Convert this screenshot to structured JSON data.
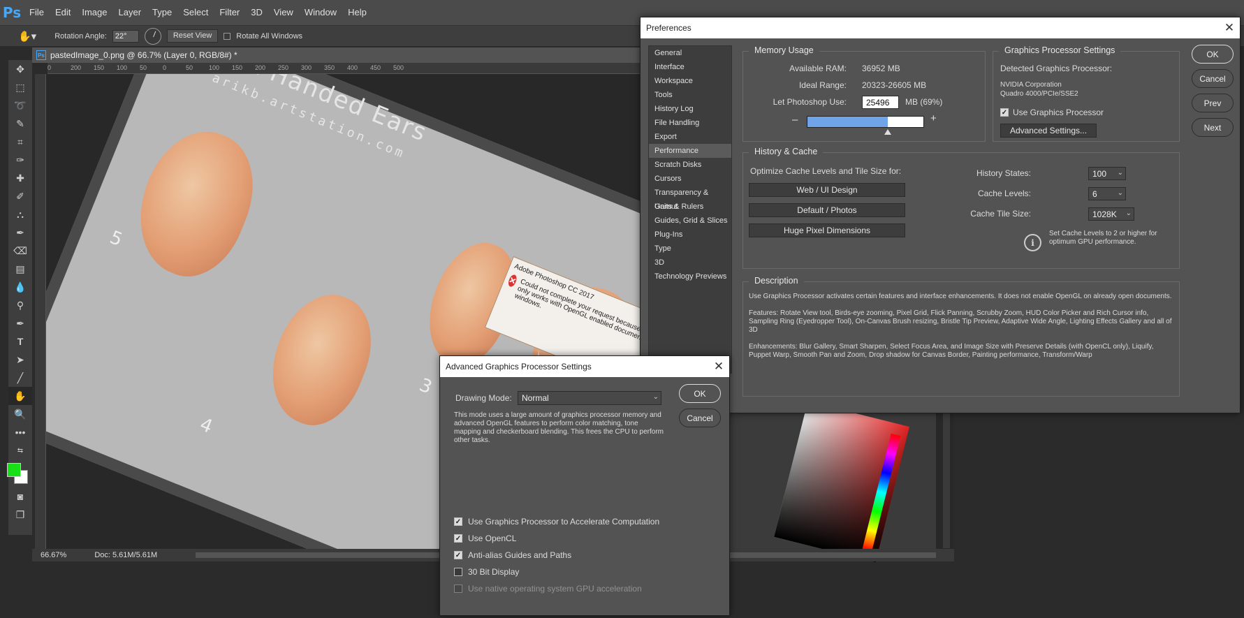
{
  "app": {
    "logo": "Ps",
    "menus": [
      "File",
      "Edit",
      "Image",
      "Layer",
      "Type",
      "Select",
      "Filter",
      "3D",
      "View",
      "Window",
      "Help"
    ]
  },
  "options_bar": {
    "rotation_angle_label": "Rotation Angle:",
    "rotation_angle_value": "22°",
    "reset_view": "Reset View",
    "rotate_all_windows": "Rotate All Windows"
  },
  "document": {
    "tab_title": "pastedImage_0.png @ 66.7% (Layer 0, RGB/8#) *",
    "zoom": "66.67%",
    "doc_size": "Doc: 5.61M/5.61M",
    "canvas_title": "Left Handed Ears",
    "canvas_url": "arikb.artstation.com",
    "ear_numbers": [
      "5",
      "3",
      "4"
    ],
    "ruler_ticks": [
      "0",
      "200",
      "150",
      "100",
      "50",
      "0",
      "50",
      "100",
      "150",
      "200",
      "250",
      "300",
      "350",
      "400",
      "450",
      "500"
    ],
    "alert": {
      "title": "Adobe Photoshop CC 2017",
      "message": "Could not complete your request because it only works with OpenGL enabled document windows."
    }
  },
  "preferences": {
    "title": "Preferences",
    "nav": [
      "General",
      "Interface",
      "Workspace",
      "Tools",
      "History Log",
      "File Handling",
      "Export",
      "Performance",
      "Scratch Disks",
      "Cursors",
      "Transparency & Gamut",
      "Units & Rulers",
      "Guides, Grid & Slices",
      "Plug-Ins",
      "Type",
      "3D",
      "Technology Previews"
    ],
    "selected_nav": "Performance",
    "buttons": {
      "ok": "OK",
      "cancel": "Cancel",
      "prev": "Prev",
      "next": "Next"
    },
    "memory": {
      "title": "Memory Usage",
      "available_label": "Available RAM:",
      "available_value": "36952 MB",
      "ideal_label": "Ideal Range:",
      "ideal_value": "20323-26605 MB",
      "let_label": "Let Photoshop Use:",
      "let_value": "25496",
      "let_suffix": "MB (69%)",
      "minus": "–",
      "plus": "+",
      "slider_fraction": 0.69
    },
    "gpu": {
      "title": "Graphics Processor Settings",
      "detected_label": "Detected Graphics Processor:",
      "vendor": "NVIDIA Corporation",
      "model": "Quadro 4000/PCIe/SSE2",
      "use_gpu": "Use Graphics Processor",
      "use_gpu_checked": true,
      "advanced_button": "Advanced Settings..."
    },
    "history_cache": {
      "title": "History & Cache",
      "optimize_label": "Optimize Cache Levels and Tile Size for:",
      "presets": [
        "Web / UI Design",
        "Default / Photos",
        "Huge Pixel Dimensions"
      ],
      "history_states_label": "History States:",
      "history_states_value": "100",
      "cache_levels_label": "Cache Levels:",
      "cache_levels_value": "6",
      "cache_tile_label": "Cache Tile Size:",
      "cache_tile_value": "1028K",
      "tip": "Set Cache Levels to 2 or higher for optimum GPU performance."
    },
    "description": {
      "title": "Description",
      "p1": "Use Graphics Processor activates certain features and interface enhancements. It does not enable OpenGL on already open documents.",
      "p2": "Features: Rotate View tool, Birds-eye zooming, Pixel Grid, Flick Panning, Scrubby Zoom, HUD Color Picker and Rich Cursor info, Sampling Ring (Eyedropper Tool), On-Canvas Brush resizing, Bristle Tip Preview, Adaptive Wide Angle, Lighting Effects Gallery and all of 3D",
      "p3": "Enhancements: Blur Gallery, Smart Sharpen, Select Focus Area, and Image Size with Preserve Details (with OpenCL only), Liquify, Puppet Warp, Smooth Pan and Zoom, Drop shadow for Canvas Border, Painting performance, Transform/Warp"
    }
  },
  "advanced": {
    "title": "Advanced Graphics Processor Settings",
    "drawing_mode_label": "Drawing Mode:",
    "drawing_mode_value": "Normal",
    "mode_description": "This mode uses a large amount of graphics processor memory and advanced OpenGL features to perform color matching, tone mapping and checkerboard blending.  This frees the CPU to perform other tasks.",
    "ok": "OK",
    "cancel": "Cancel",
    "checkboxes": [
      {
        "label": "Use Graphics Processor to Accelerate Computation",
        "checked": true,
        "disabled": false
      },
      {
        "label": "Use OpenCL",
        "checked": true,
        "disabled": false
      },
      {
        "label": "Anti-alias Guides and Paths",
        "checked": true,
        "disabled": false
      },
      {
        "label": "30 Bit Display",
        "checked": false,
        "disabled": false
      },
      {
        "label": "Use native operating system GPU acceleration",
        "checked": false,
        "disabled": true
      }
    ]
  },
  "colors": {
    "accent_blue": "#6fa4e8",
    "foreground_swatch": "#18e018",
    "background_swatch": "#ffffff"
  }
}
